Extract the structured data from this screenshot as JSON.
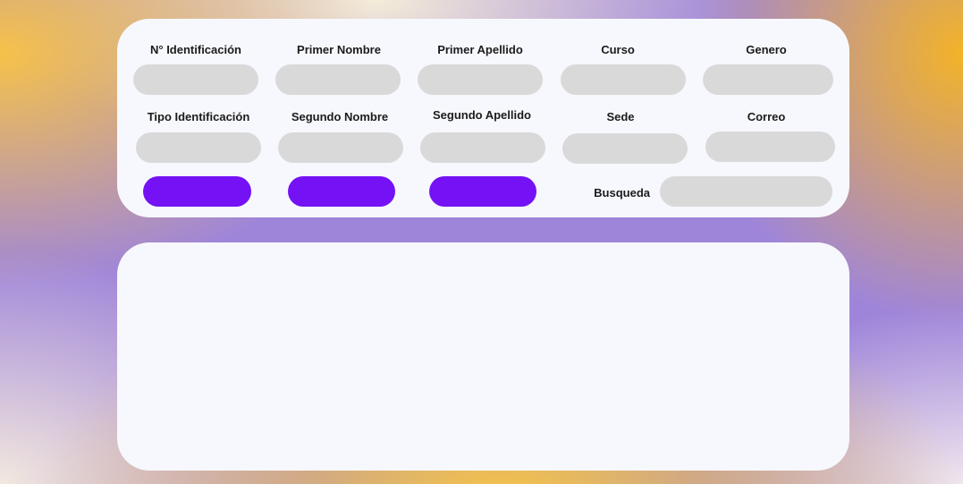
{
  "form": {
    "labels": {
      "id_number": "N° Identificación",
      "first_name": "Primer Nombre",
      "first_surname": "Primer Apellido",
      "course": "Curso",
      "gender": "Genero",
      "id_type": "Tipo Identificación",
      "second_name": "Segundo Nombre",
      "second_surname": "Segundo Apellido",
      "campus": "Sede",
      "email": "Correo",
      "search": "Busqueda"
    },
    "values": {
      "id_number": "",
      "first_name": "",
      "first_surname": "",
      "course": "",
      "gender": "",
      "id_type": "",
      "second_name": "",
      "second_surname": "",
      "campus": "",
      "email": "",
      "search": ""
    },
    "buttons": {
      "button_1": "",
      "button_2": "",
      "button_3": ""
    }
  },
  "colors": {
    "button": "#7412f5",
    "input": "#d9d9d9",
    "panel": "#f7f8fd"
  }
}
